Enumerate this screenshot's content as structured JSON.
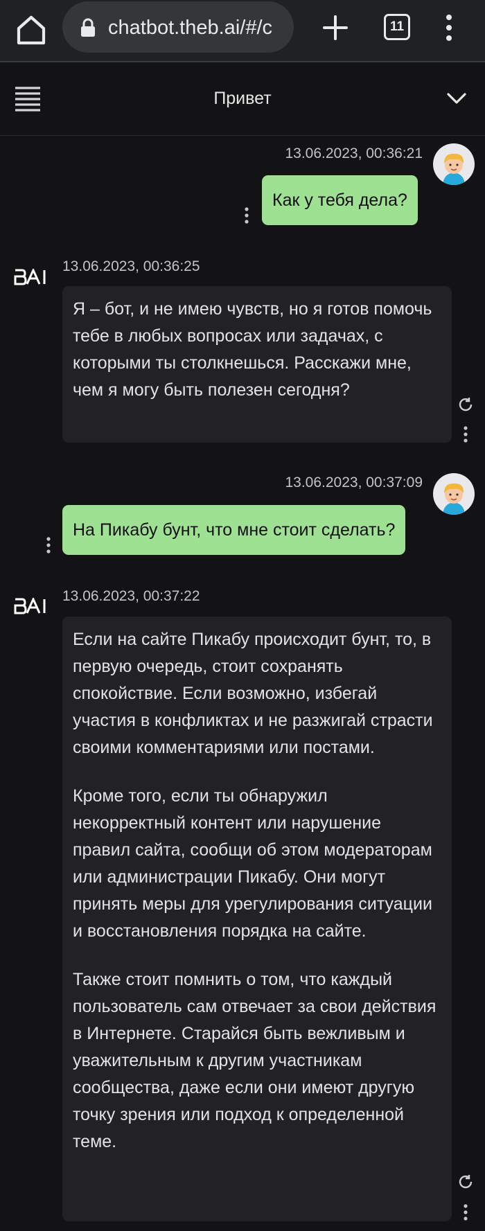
{
  "browser": {
    "url": "chatbot.theb.ai/#/c",
    "tab_count": "11"
  },
  "header": {
    "title": "Привет"
  },
  "messages": [
    {
      "role": "user",
      "timestamp": "13.06.2023, 00:36:21",
      "text": "Как у тебя дела?"
    },
    {
      "role": "bot",
      "sender": "BAI",
      "timestamp": "13.06.2023, 00:36:25",
      "paragraphs": [
        "Я – бот, и не имею чувств, но я готов помочь тебе в любых вопросах или задачах, с которыми ты столкнешься. Расскажи мне, чем я могу быть полезен сегодня?"
      ]
    },
    {
      "role": "user",
      "timestamp": "13.06.2023, 00:37:09",
      "text": "На Пикабу бунт, что мне стоит сделать?"
    },
    {
      "role": "bot",
      "sender": "BAI",
      "timestamp": "13.06.2023, 00:37:22",
      "paragraphs": [
        "Если на сайте Пикабу происходит бунт, то, в первую очередь, стоит сохранять спокойствие. Если возможно, избегай участия в конфликтах и не разжигай страсти своими комментариями или постами.",
        "Кроме того, если ты обнаружил некорректный контент или нарушение правил сайта, сообщи об этом модераторам или администрации Пикабу. Они могут принять меры для урегулирования ситуации и восстановления порядка на сайте.",
        "Также стоит помнить о том, что каждый пользователь сам отвечает за свои действия в Интернете. Старайся быть вежливым и уважительным к другим участникам сообщества, даже если они имеют другую точку зрения или подход к определенной теме."
      ]
    }
  ],
  "colors": {
    "background": "#131316",
    "user_bubble": "#9ee193",
    "bot_bubble": "#222225"
  },
  "icons": [
    "home-icon",
    "lock-icon",
    "plus-icon",
    "tabs-icon",
    "more-vert-icon",
    "hamburger-icon",
    "chevron-down-icon",
    "avatar",
    "bai-logo",
    "regenerate-icon"
  ]
}
